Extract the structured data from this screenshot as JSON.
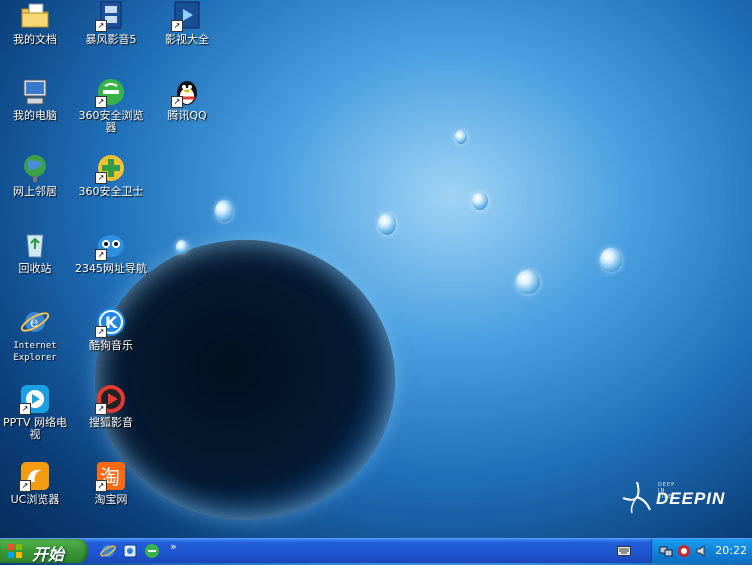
{
  "desktop": {
    "icons": [
      {
        "label": "我的文档",
        "icon": "folder-documents-icon"
      },
      {
        "label": "暴风影音5",
        "icon": "baofeng-player-icon"
      },
      {
        "label": "影视大全",
        "icon": "video-library-icon"
      },
      {
        "label": "我的电脑",
        "icon": "my-computer-icon"
      },
      {
        "label": "360安全浏览器",
        "icon": "360-browser-icon"
      },
      {
        "label": "腾讯QQ",
        "icon": "qq-penguin-icon"
      },
      {
        "label": "网上邻居",
        "icon": "network-places-icon"
      },
      {
        "label": "360安全卫士",
        "icon": "360-security-icon"
      },
      {
        "label": "回收站",
        "icon": "recycle-bin-icon"
      },
      {
        "label": "2345网址导航",
        "icon": "2345-navigation-icon"
      },
      {
        "label": "Internet Explorer",
        "icon": "internet-explorer-icon"
      },
      {
        "label": "酷狗音乐",
        "icon": "kugou-music-icon"
      },
      {
        "label": "PPTV 网络电视",
        "icon": "pptv-icon"
      },
      {
        "label": "搜狐影音",
        "icon": "sohu-video-icon"
      },
      {
        "label": "UC浏览器",
        "icon": "uc-browser-icon"
      },
      {
        "label": "淘宝网",
        "icon": "taobao-icon"
      }
    ],
    "wallpaper_brand": {
      "small": "DEEP IN LIFE",
      "big": "DEEPIN"
    }
  },
  "taskbar": {
    "start_label": "开始",
    "quick_launch_more": "»",
    "clock": "20:22"
  }
}
